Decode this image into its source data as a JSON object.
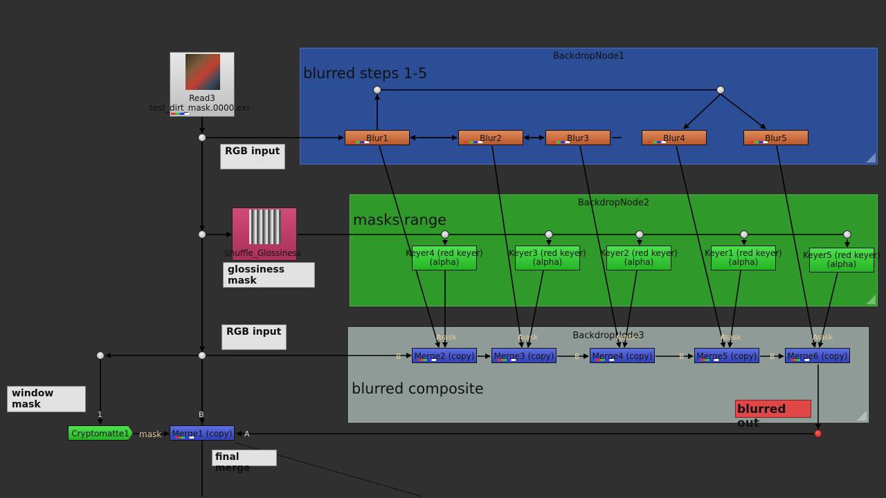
{
  "backdrops": {
    "bd1": {
      "title": "BackdropNode1",
      "label": "blurred steps 1-5",
      "color": "#2c4e96"
    },
    "bd2": {
      "title": "BackdropNode2",
      "label": "masks range",
      "color": "#2f9a2a"
    },
    "bd3": {
      "title": "BackdropNode3",
      "label": "blurred composite",
      "color": "#8e9b96"
    }
  },
  "nodes": {
    "read3": {
      "name": "Read3",
      "file": "test_dirt_mask.0000.exr"
    },
    "shuffle": {
      "name": "Shuffle_Glossiness"
    },
    "blur1": "Blur1",
    "blur2": "Blur2",
    "blur3": "Blur3",
    "blur4": "Blur4",
    "blur5": "Blur5",
    "keyer4": {
      "line1": "Keyer4 (red keyer)",
      "line2": "(alpha)"
    },
    "keyer3": {
      "line1": "Keyer3 (red keyer)",
      "line2": "(alpha)"
    },
    "keyer2": {
      "line1": "Keyer2 (red keyer)",
      "line2": "(alpha)"
    },
    "keyer1": {
      "line1": "Keyer1 (red keyer)",
      "line2": "(alpha)"
    },
    "keyer5": {
      "line1": "Keyer5 (red keyer)",
      "line2": "(alpha)"
    },
    "merge2": "Merge2 (copy)",
    "merge3": "Merge3 (copy)",
    "merge4": "Merge4 (copy)",
    "merge5": "Merge5 (copy)",
    "merge6": "Merge6 (copy)",
    "merge1": "Merge1 (copy)",
    "cryptomatte": "Cryptomatte1"
  },
  "notes": {
    "rgb_input_1": "RGB input",
    "glossiness_mask": "glossiness mask",
    "rgb_input_2": "RGB input",
    "window_mask": "window mask",
    "blurred_out": "blurred out",
    "final_merge": "final merge"
  },
  "input_labels": {
    "a": "A",
    "b": "B",
    "mask": "mask",
    "one": "1"
  },
  "colors": {
    "blur_node": "#c8683a",
    "merge_node": "#4050c8",
    "keyer_node": "#36c836",
    "shuffle_node": "#c0406a",
    "note": "#e2e2e2",
    "blurred_out_note": "#e04848",
    "viewer_dot": "#e02020"
  }
}
